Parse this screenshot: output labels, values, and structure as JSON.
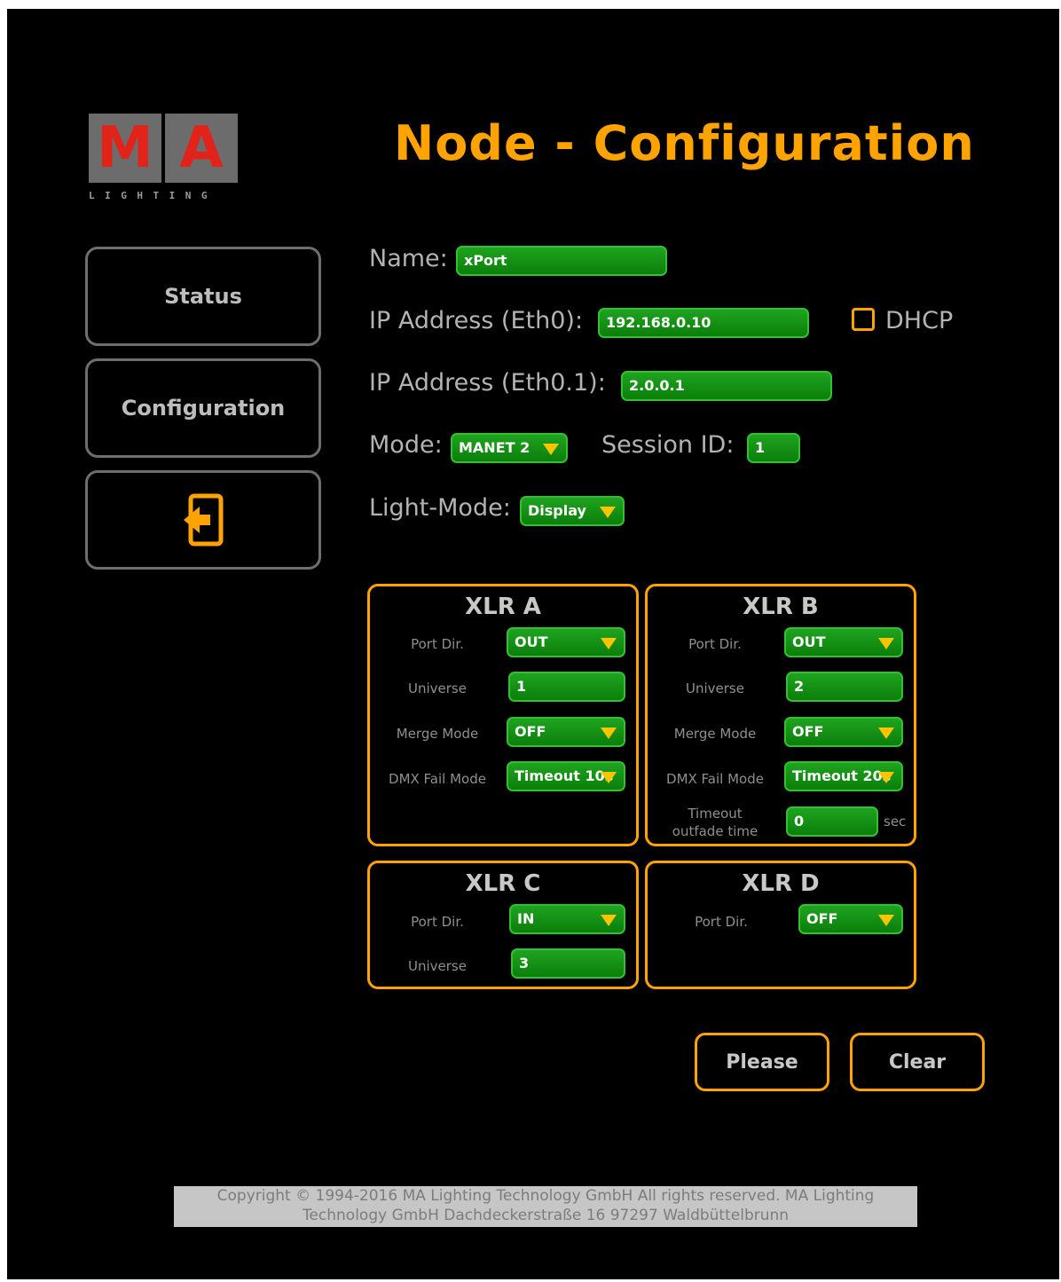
{
  "logo": {
    "letter_m": "M",
    "letter_a": "A",
    "sub": "LIGHTING"
  },
  "page_title": "Node - Configuration",
  "nav": {
    "status": "Status",
    "configuration": "Configuration",
    "logout_icon": "logout-icon"
  },
  "form": {
    "name_label": "Name:",
    "name_value": "xPort",
    "ip_eth0_label": "IP Address (Eth0):",
    "ip_eth0_value": "192.168.0.10",
    "dhcp_label": "DHCP",
    "dhcp_checked": false,
    "ip_eth01_label": "IP Address (Eth0.1):",
    "ip_eth01_value": "2.0.0.1",
    "mode_label": "Mode:",
    "mode_value": "MANET 2",
    "session_label": "Session ID:",
    "session_value": "1",
    "light_mode_label": "Light-Mode:",
    "light_mode_value": "Display"
  },
  "xlr_a": {
    "title": "XLR A",
    "port_dir_label": "Port Dir.",
    "port_dir_value": "OUT",
    "universe_label": "Universe",
    "universe_value": "1",
    "merge_label": "Merge Mode",
    "merge_value": "OFF",
    "dmx_fail_label": "DMX Fail Mode",
    "dmx_fail_value": "Timeout 10s"
  },
  "xlr_b": {
    "title": "XLR B",
    "port_dir_label": "Port Dir.",
    "port_dir_value": "OUT",
    "universe_label": "Universe",
    "universe_value": "2",
    "merge_label": "Merge Mode",
    "merge_value": "OFF",
    "dmx_fail_label": "DMX Fail Mode",
    "dmx_fail_value": "Timeout 20s",
    "timeout_label_1": "Timeout",
    "timeout_label_2": "outfade time",
    "timeout_value": "0",
    "timeout_unit": "sec"
  },
  "xlr_c": {
    "title": "XLR C",
    "port_dir_label": "Port Dir.",
    "port_dir_value": "IN",
    "universe_label": "Universe",
    "universe_value": "3"
  },
  "xlr_d": {
    "title": "XLR D",
    "port_dir_label": "Port Dir.",
    "port_dir_value": "OFF"
  },
  "buttons": {
    "please": "Please",
    "clear": "Clear"
  },
  "footer": {
    "line1": "Copyright © 1994-2016 MA Lighting Technology GmbH All rights reserved. MA Lighting",
    "line2": "Technology GmbH Dachdeckerstraße 16 97297 Waldbüttelbrunn"
  },
  "colors": {
    "accent": "#ffa300",
    "field_green": "#1a9a1a",
    "logo_red": "#e2231a",
    "background": "#000000"
  }
}
